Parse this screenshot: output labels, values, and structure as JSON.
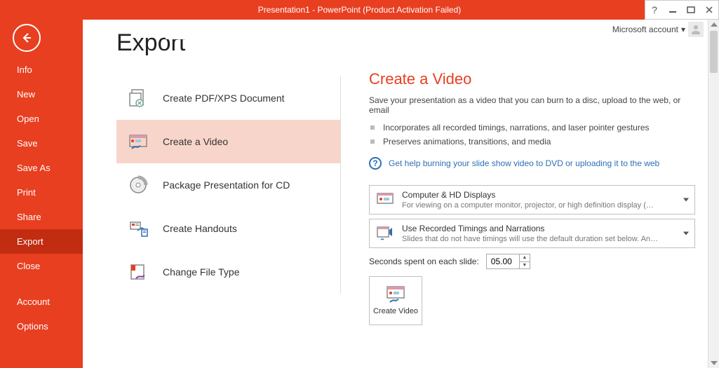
{
  "titlebar": {
    "title": "Presentation1 -  PowerPoint (Product Activation Failed)"
  },
  "account": {
    "label": "Microsoft account"
  },
  "sidebar": {
    "items": [
      {
        "label": "Info"
      },
      {
        "label": "New"
      },
      {
        "label": "Open"
      },
      {
        "label": "Save"
      },
      {
        "label": "Save As"
      },
      {
        "label": "Print"
      },
      {
        "label": "Share"
      },
      {
        "label": "Export"
      },
      {
        "label": "Close"
      },
      {
        "label": "Account"
      },
      {
        "label": "Options"
      }
    ],
    "selected_index": 7
  },
  "page": {
    "title": "Export"
  },
  "export_options": [
    {
      "label": "Create PDF/XPS Document"
    },
    {
      "label": "Create a Video"
    },
    {
      "label": "Package Presentation for CD"
    },
    {
      "label": "Create Handouts"
    },
    {
      "label": "Change File Type"
    }
  ],
  "export_selected_index": 1,
  "panel": {
    "title": "Create a Video",
    "desc": "Save your presentation as a video that you can burn to a disc, upload to the web, or email",
    "bullets": [
      "Incorporates all recorded timings, narrations, and laser pointer gestures",
      "Preserves animations, transitions, and media"
    ],
    "help_link": "Get help burning your slide show video to DVD or uploading it to the web",
    "quality": {
      "title": "Computer & HD Displays",
      "sub": "For viewing on a computer monitor, projector, or high definition display  (…"
    },
    "timings": {
      "title": "Use Recorded Timings and Narrations",
      "sub": "Slides that do not have timings will use the default duration set below. Any…"
    },
    "seconds_label": "Seconds spent on each slide:",
    "seconds_value": "05.00",
    "create_button": "Create Video"
  }
}
